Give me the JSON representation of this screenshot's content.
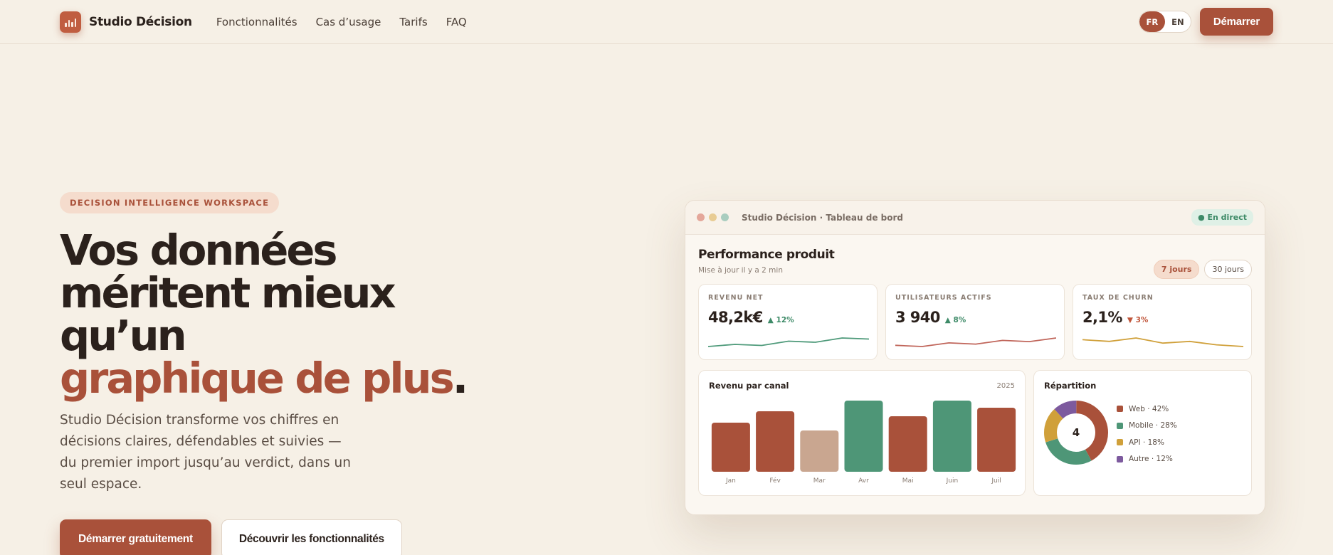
{
  "nav": {
    "brand": "Studio Décision",
    "links": [
      "Fonctionnalités",
      "Cas d’usage",
      "Tarifs",
      "FAQ"
    ],
    "lang": [
      "FR",
      "EN"
    ],
    "lang_active": "FR",
    "cta": "Démarrer"
  },
  "hero": {
    "tag": "DECISION INTELLIGENCE WORKSPACE",
    "headline_line1": "Vos données",
    "headline_line2": "méritent mieux qu’un",
    "headline_accent": "graphique de plus",
    "headline_end": ".",
    "lead": "Studio Décision transforme vos chiffres en décisions claires, défendables et suivies — du premier import jusqu’au verdict, dans un seul espace.",
    "primary_cta": "Démarrer gratuitement",
    "secondary_cta": "Découvrir les fonctionnalités"
  },
  "dashboard": {
    "window_title": "Studio Décision · Tableau de bord",
    "live_badge": "● En direct",
    "title": "Performance produit",
    "subtitle": "Mise à jour il y a 2 min",
    "periods": [
      "7 jours",
      "30 jours"
    ],
    "period_active": "7 jours",
    "kpis": [
      {
        "label": "REVENU NET",
        "value": "48,2k€",
        "delta": "▲ 12%",
        "trend": "up",
        "color": "#4e9a7a",
        "spark": [
          2,
          4,
          3,
          7,
          6,
          10,
          9
        ]
      },
      {
        "label": "UTILISATEURS ACTIFS",
        "value": "3 940",
        "delta": "▲ 8%",
        "trend": "up",
        "color": "#c0655a",
        "spark": [
          3,
          2,
          5,
          4,
          7,
          6,
          9
        ]
      },
      {
        "label": "TAUX DE CHURN",
        "value": "2,1%",
        "delta": "▼ 3%",
        "trend": "down",
        "color": "#d0a03a",
        "spark": [
          8,
          7,
          9,
          6,
          7,
          5,
          4
        ]
      }
    ],
    "channel": {
      "title": "Revenu par canal",
      "year": "2025",
      "chart_data": {
        "type": "bar",
        "categories": [
          "Jan",
          "Fév",
          "Mar",
          "Avr",
          "Mai",
          "Juin",
          "Juil"
        ],
        "values": [
          69,
          85,
          58,
          100,
          78,
          100,
          90
        ],
        "colors": [
          "#a9513a",
          "#a9513a",
          "#c9a690",
          "#4e9677",
          "#a9513a",
          "#4e9677",
          "#a9513a"
        ],
        "ylim": [
          0,
          100
        ]
      }
    },
    "split": {
      "title": "Répartition",
      "center": "4",
      "chart_data": {
        "type": "pie",
        "labels": [
          "Web · 42%",
          "Mobile · 28%",
          "API · 18%",
          "Autre · 12%"
        ],
        "values": [
          42,
          28,
          18,
          12
        ],
        "colors": [
          "#a9513a",
          "#4e9677",
          "#d0a03a",
          "#7d5a9e"
        ]
      }
    },
    "window_dots": [
      "#e4a79a",
      "#e8cc94",
      "#a9cdbf"
    ]
  }
}
